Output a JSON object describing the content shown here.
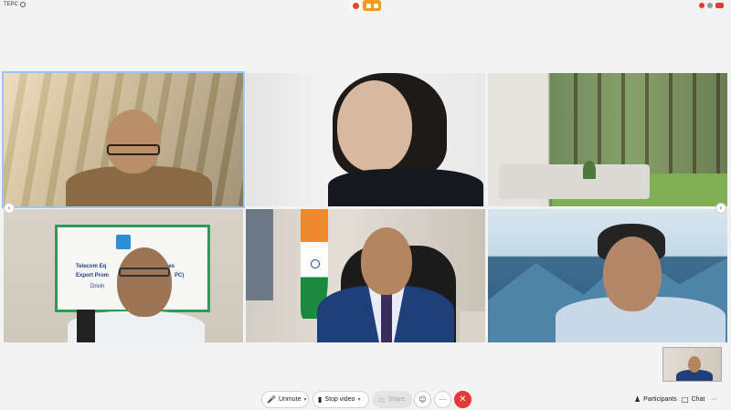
{
  "app": {
    "title": "TEPC"
  },
  "tiles": [
    {
      "name": "participant-tile-1"
    },
    {
      "name": "participant-tile-2"
    },
    {
      "name": "participant-tile-3"
    },
    {
      "name": "participant-tile-4",
      "sign_text_1": "Telecom Eq",
      "sign_text_2": "ces",
      "sign_text_3": "Export Prom",
      "sign_text_4": "PC)",
      "sign_text_5": "Drivin"
    },
    {
      "name": "participant-tile-5"
    },
    {
      "name": "participant-tile-6"
    }
  ],
  "toolbar": {
    "unmute_label": "Unmute",
    "stop_video_label": "Stop video",
    "share_label": "Share",
    "participants_label": "Participants",
    "chat_label": "Chat",
    "more_glyph": "···",
    "end_glyph": "✕"
  },
  "colors": {
    "end_call": "#e53935",
    "active_border": "#9ec5f0",
    "accent": "#f49b1c"
  }
}
